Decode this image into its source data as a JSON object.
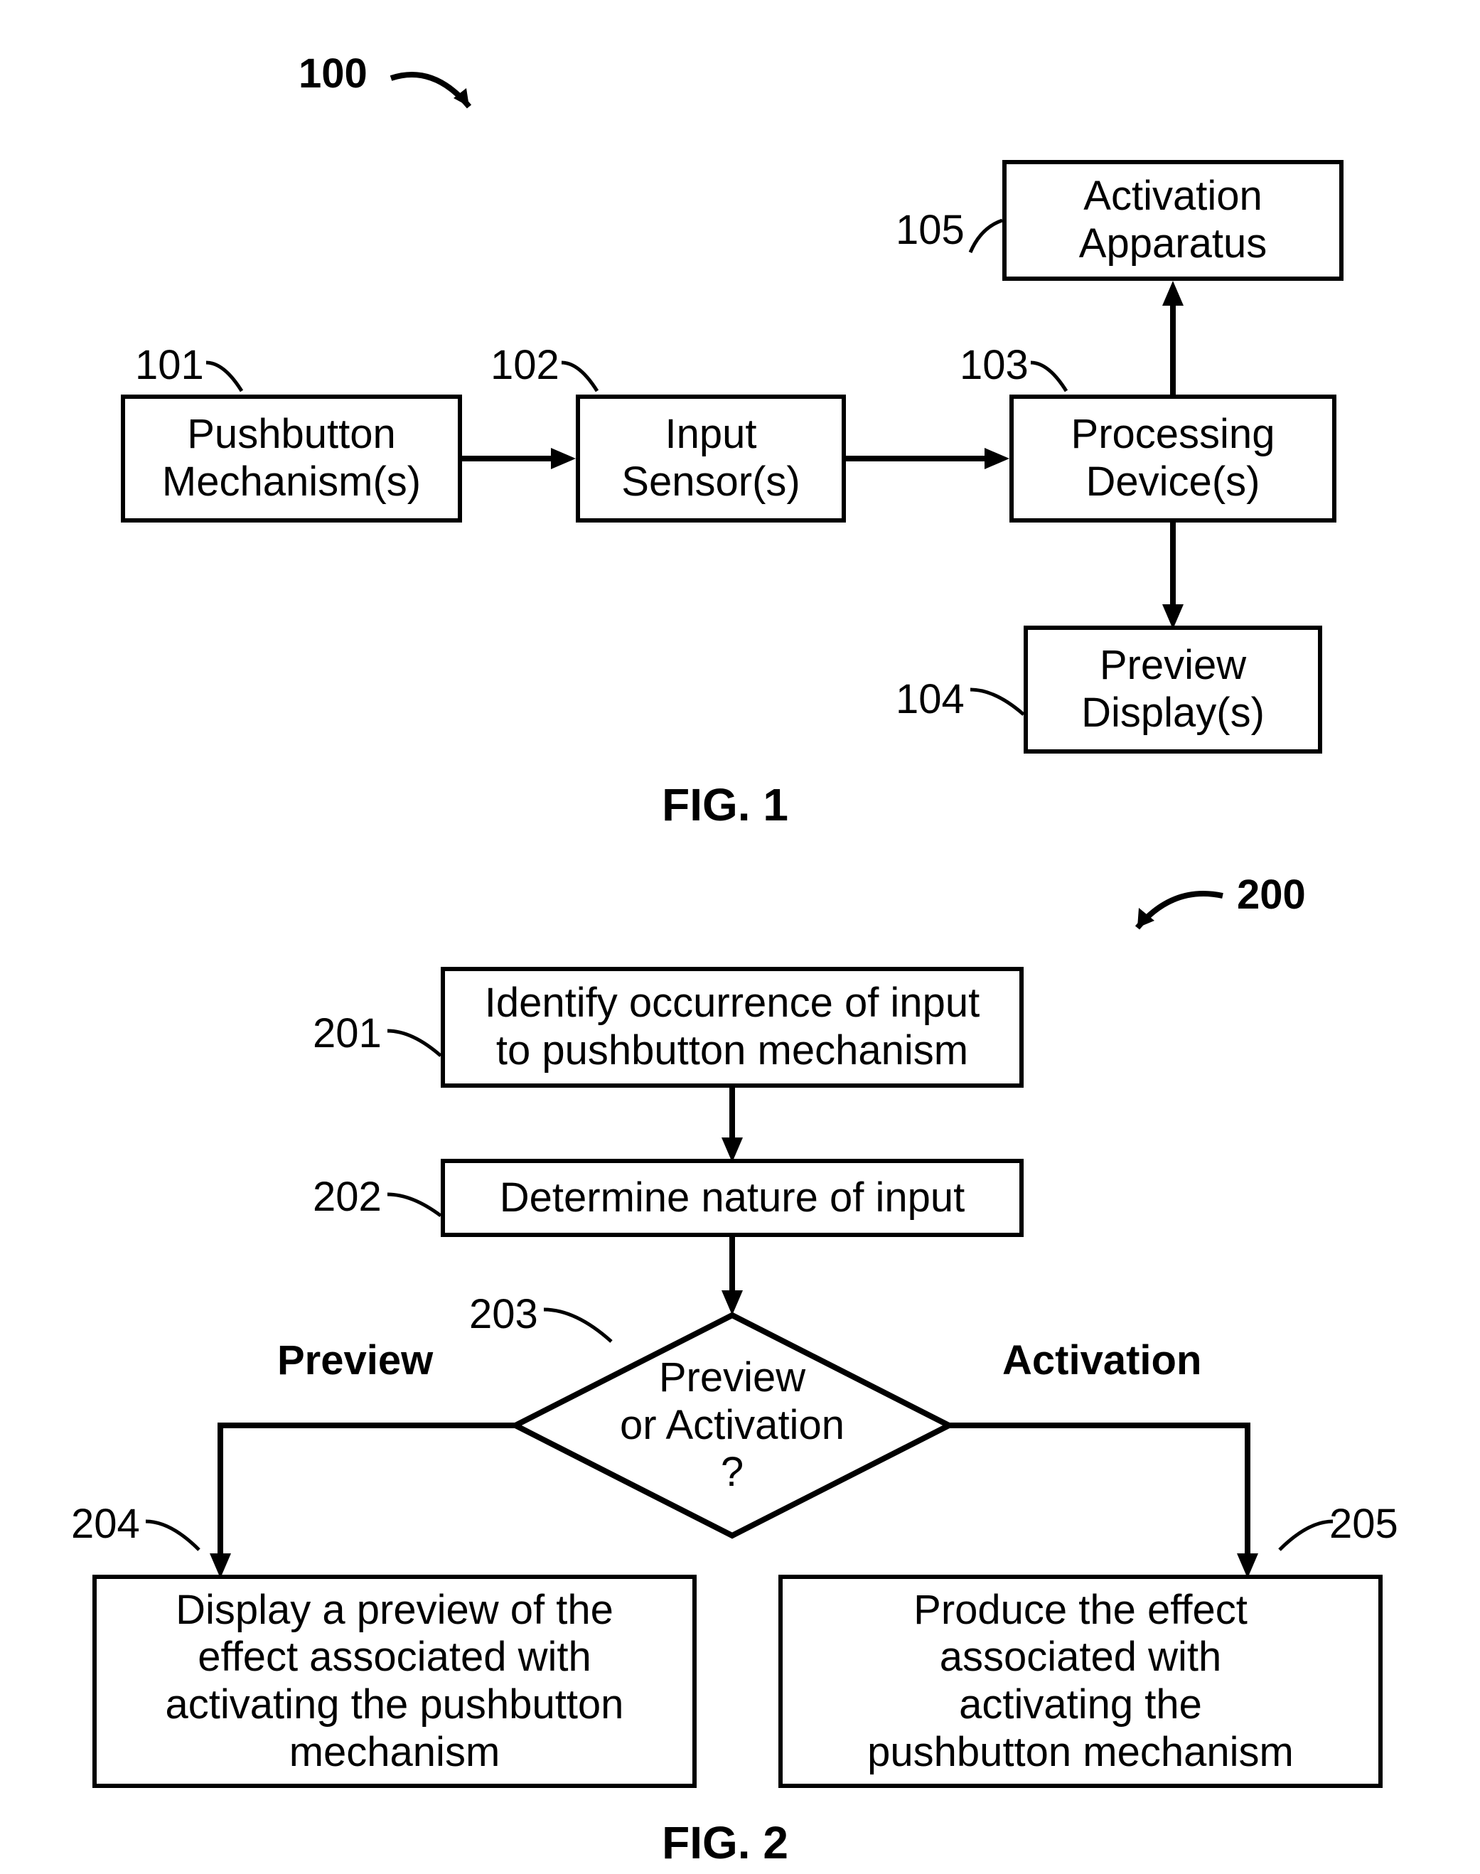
{
  "fig1": {
    "ref_label": "100",
    "caption": "FIG. 1",
    "boxes": {
      "pushbutton": {
        "id": "101",
        "text": "Pushbutton\nMechanism(s)"
      },
      "input_sensor": {
        "id": "102",
        "text": "Input\nSensor(s)"
      },
      "processing": {
        "id": "103",
        "text": "Processing\nDevice(s)"
      },
      "activation": {
        "id": "105",
        "text": "Activation\nApparatus"
      },
      "preview": {
        "id": "104",
        "text": "Preview\nDisplay(s)"
      }
    }
  },
  "fig2": {
    "ref_label": "200",
    "caption": "FIG. 2",
    "boxes": {
      "identify": {
        "id": "201",
        "text": "Identify occurrence of input\nto pushbutton mechanism"
      },
      "determine": {
        "id": "202",
        "text": "Determine nature of input"
      },
      "decision": {
        "id": "203",
        "text": "Preview\nor Activation\n?"
      },
      "display_preview": {
        "id": "204",
        "text": "Display a preview of the\neffect associated with\nactivating the pushbutton\nmechanism"
      },
      "produce_effect": {
        "id": "205",
        "text": "Produce the effect\nassociated with\nactivating the\npushbutton mechanism"
      }
    },
    "branch_labels": {
      "preview": "Preview",
      "activation": "Activation"
    }
  },
  "chart_data": {
    "type": "diagram",
    "figures": [
      {
        "name": "FIG. 1",
        "ref": "100",
        "kind": "block-diagram",
        "nodes": [
          {
            "id": "101",
            "label": "Pushbutton Mechanism(s)"
          },
          {
            "id": "102",
            "label": "Input Sensor(s)"
          },
          {
            "id": "103",
            "label": "Processing Device(s)"
          },
          {
            "id": "104",
            "label": "Preview Display(s)"
          },
          {
            "id": "105",
            "label": "Activation Apparatus"
          }
        ],
        "edges": [
          {
            "from": "101",
            "to": "102"
          },
          {
            "from": "102",
            "to": "103"
          },
          {
            "from": "103",
            "to": "105"
          },
          {
            "from": "103",
            "to": "104"
          }
        ]
      },
      {
        "name": "FIG. 2",
        "ref": "200",
        "kind": "flowchart",
        "nodes": [
          {
            "id": "201",
            "label": "Identify occurrence of input to pushbutton mechanism",
            "shape": "process"
          },
          {
            "id": "202",
            "label": "Determine nature of input",
            "shape": "process"
          },
          {
            "id": "203",
            "label": "Preview or Activation ?",
            "shape": "decision"
          },
          {
            "id": "204",
            "label": "Display a preview of the effect associated with activating the pushbutton mechanism",
            "shape": "process"
          },
          {
            "id": "205",
            "label": "Produce the effect associated with activating the pushbutton mechanism",
            "shape": "process"
          }
        ],
        "edges": [
          {
            "from": "201",
            "to": "202"
          },
          {
            "from": "202",
            "to": "203"
          },
          {
            "from": "203",
            "to": "204",
            "label": "Preview"
          },
          {
            "from": "203",
            "to": "205",
            "label": "Activation"
          }
        ]
      }
    ]
  }
}
